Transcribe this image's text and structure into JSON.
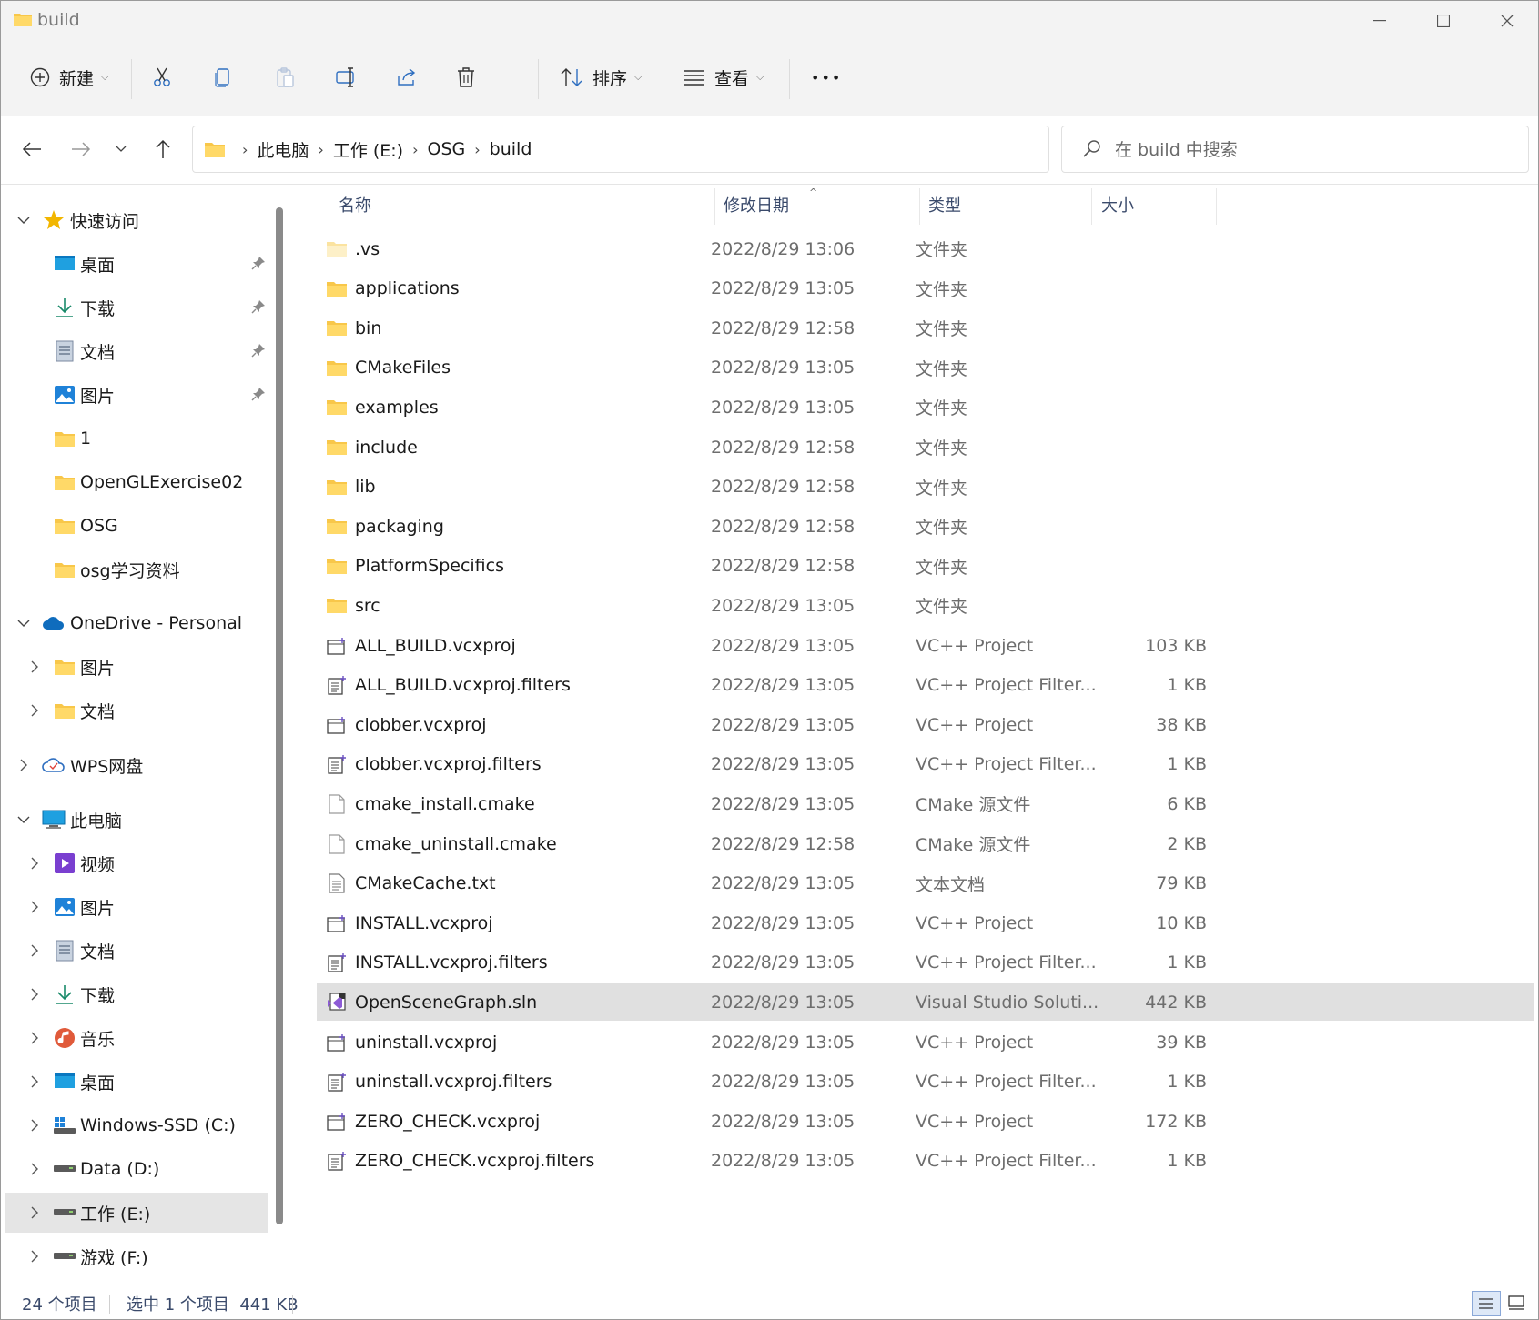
{
  "window": {
    "title": "build"
  },
  "command_bar": {
    "new_label": "新建",
    "sort_label": "排序",
    "view_label": "查看",
    "more_label": "•••"
  },
  "address": {
    "crumbs": [
      "此电脑",
      "工作 (E:)",
      "OSG",
      "build"
    ],
    "search_placeholder": "在 build 中搜索"
  },
  "nav": {
    "quick_access": "快速访问",
    "quick_items": [
      "桌面",
      "下载",
      "文档",
      "图片",
      "1",
      "OpenGLExercise02",
      "OSG",
      "osg学习资料"
    ],
    "onedrive": "OneDrive - Personal",
    "onedrive_items": [
      "图片",
      "文档"
    ],
    "wps": "WPS网盘",
    "this_pc": "此电脑",
    "pc_items": [
      "视频",
      "图片",
      "文档",
      "下载",
      "音乐",
      "桌面",
      "Windows-SSD (C:)",
      "Data (D:)",
      "工作 (E:)",
      "游戏 (F:)"
    ]
  },
  "columns": {
    "name": "名称",
    "date": "修改日期",
    "type": "类型",
    "size": "大小"
  },
  "files": [
    {
      "name": ".vs",
      "date": "2022/8/29 13:06",
      "type": "文件夹",
      "size": "",
      "icon": "folder-light"
    },
    {
      "name": "applications",
      "date": "2022/8/29 13:05",
      "type": "文件夹",
      "size": "",
      "icon": "folder"
    },
    {
      "name": "bin",
      "date": "2022/8/29 12:58",
      "type": "文件夹",
      "size": "",
      "icon": "folder"
    },
    {
      "name": "CMakeFiles",
      "date": "2022/8/29 13:05",
      "type": "文件夹",
      "size": "",
      "icon": "folder"
    },
    {
      "name": "examples",
      "date": "2022/8/29 13:05",
      "type": "文件夹",
      "size": "",
      "icon": "folder"
    },
    {
      "name": "include",
      "date": "2022/8/29 12:58",
      "type": "文件夹",
      "size": "",
      "icon": "folder"
    },
    {
      "name": "lib",
      "date": "2022/8/29 12:58",
      "type": "文件夹",
      "size": "",
      "icon": "folder"
    },
    {
      "name": "packaging",
      "date": "2022/8/29 12:58",
      "type": "文件夹",
      "size": "",
      "icon": "folder"
    },
    {
      "name": "PlatformSpecifics",
      "date": "2022/8/29 12:58",
      "type": "文件夹",
      "size": "",
      "icon": "folder"
    },
    {
      "name": "src",
      "date": "2022/8/29 13:05",
      "type": "文件夹",
      "size": "",
      "icon": "folder"
    },
    {
      "name": "ALL_BUILD.vcxproj",
      "date": "2022/8/29 13:05",
      "type": "VC++ Project",
      "size": "103 KB",
      "icon": "vcxproj"
    },
    {
      "name": "ALL_BUILD.vcxproj.filters",
      "date": "2022/8/29 13:05",
      "type": "VC++ Project Filter...",
      "size": "1 KB",
      "icon": "filters"
    },
    {
      "name": "clobber.vcxproj",
      "date": "2022/8/29 13:05",
      "type": "VC++ Project",
      "size": "38 KB",
      "icon": "vcxproj"
    },
    {
      "name": "clobber.vcxproj.filters",
      "date": "2022/8/29 13:05",
      "type": "VC++ Project Filter...",
      "size": "1 KB",
      "icon": "filters"
    },
    {
      "name": "cmake_install.cmake",
      "date": "2022/8/29 13:05",
      "type": "CMake 源文件",
      "size": "6 KB",
      "icon": "doc"
    },
    {
      "name": "cmake_uninstall.cmake",
      "date": "2022/8/29 12:58",
      "type": "CMake 源文件",
      "size": "2 KB",
      "icon": "doc"
    },
    {
      "name": "CMakeCache.txt",
      "date": "2022/8/29 13:05",
      "type": "文本文档",
      "size": "79 KB",
      "icon": "txt"
    },
    {
      "name": "INSTALL.vcxproj",
      "date": "2022/8/29 13:05",
      "type": "VC++ Project",
      "size": "10 KB",
      "icon": "vcxproj"
    },
    {
      "name": "INSTALL.vcxproj.filters",
      "date": "2022/8/29 13:05",
      "type": "VC++ Project Filter...",
      "size": "1 KB",
      "icon": "filters"
    },
    {
      "name": "OpenSceneGraph.sln",
      "date": "2022/8/29 13:05",
      "type": "Visual Studio Soluti...",
      "size": "442 KB",
      "icon": "sln"
    },
    {
      "name": "uninstall.vcxproj",
      "date": "2022/8/29 13:05",
      "type": "VC++ Project",
      "size": "39 KB",
      "icon": "vcxproj"
    },
    {
      "name": "uninstall.vcxproj.filters",
      "date": "2022/8/29 13:05",
      "type": "VC++ Project Filter...",
      "size": "1 KB",
      "icon": "filters"
    },
    {
      "name": "ZERO_CHECK.vcxproj",
      "date": "2022/8/29 13:05",
      "type": "VC++ Project",
      "size": "172 KB",
      "icon": "vcxproj"
    },
    {
      "name": "ZERO_CHECK.vcxproj.filters",
      "date": "2022/8/29 13:05",
      "type": "VC++ Project Filter...",
      "size": "1 KB",
      "icon": "filters"
    }
  ],
  "selected_file": "OpenSceneGraph.sln",
  "status": {
    "count": "24 个项目",
    "selection": "选中 1 个项目  441 KB"
  },
  "colors": {
    "folder": "#f8c74a",
    "selection": "#e0e0e0",
    "accent": "#0067c0"
  }
}
